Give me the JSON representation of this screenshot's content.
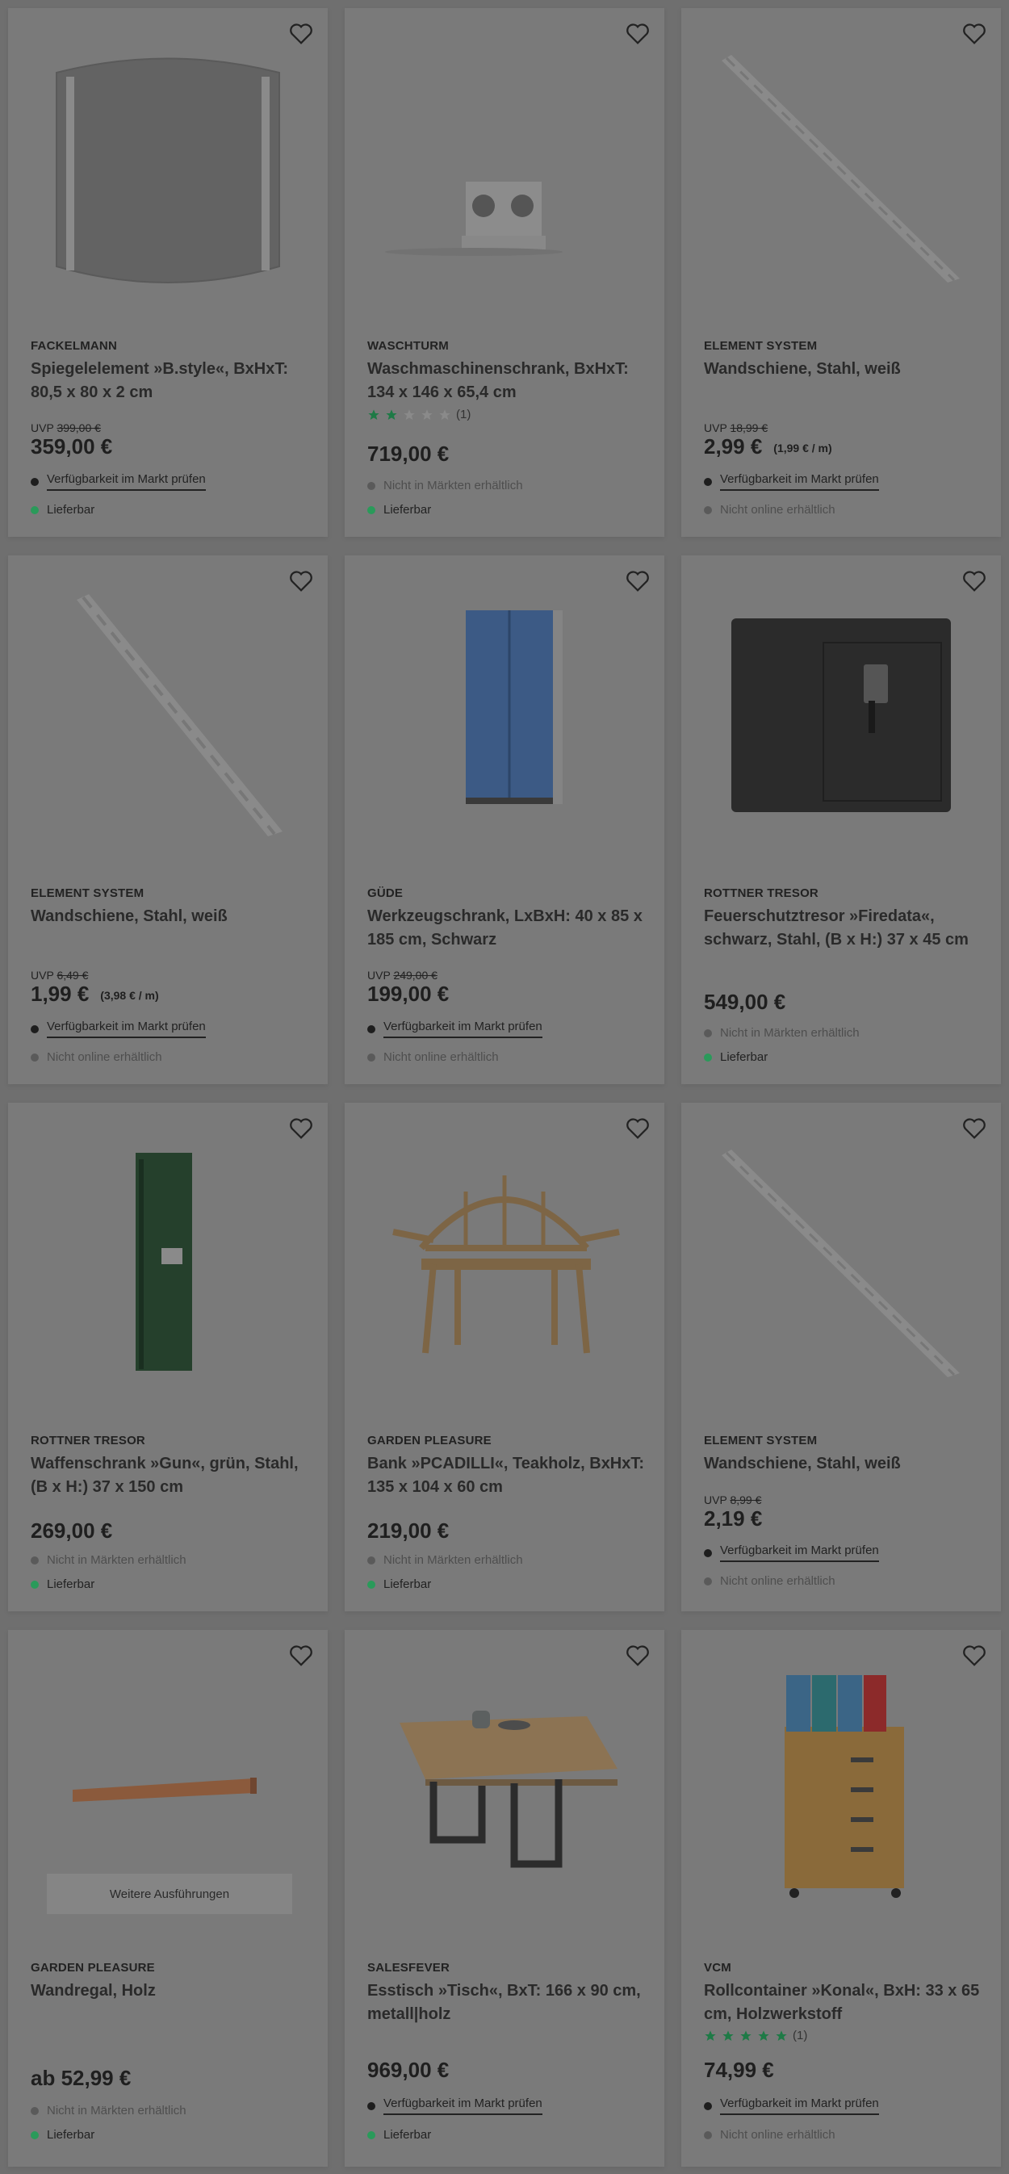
{
  "products": [
    {
      "brand": "FACKELMANN",
      "title": "Spiegelelement »B.style«, BxHxT: 80,5 x 80 x 2 cm",
      "uvp_label": "UVP",
      "uvp_price": "399,00 €",
      "price": "359,00 €",
      "availability": [
        {
          "label": "Verfügbarkeit im Markt prüfen",
          "status": "dark",
          "link": true
        },
        {
          "label": "Lieferbar",
          "status": "green",
          "link": false
        }
      ]
    },
    {
      "brand": "WASCHTURM",
      "title": "Waschmaschinenschrank, BxHxT: 134 x 146 x 65,4 cm",
      "rating": {
        "value": 2,
        "max": 5,
        "count": "(1)"
      },
      "price": "719,00 €",
      "availability": [
        {
          "label": "Nicht in Märkten erhältlich",
          "status": "grey",
          "link": false
        },
        {
          "label": "Lieferbar",
          "status": "green",
          "link": false
        }
      ]
    },
    {
      "brand": "ELEMENT SYSTEM",
      "title": "Wandschiene, Stahl, weiß",
      "uvp_label": "UVP",
      "uvp_price": "18,99 €",
      "price": "2,99 €",
      "unit_price": "(1,99 € / m)",
      "availability": [
        {
          "label": "Verfügbarkeit im Markt prüfen",
          "status": "dark",
          "link": true
        },
        {
          "label": "Nicht online erhältlich",
          "status": "grey",
          "link": false
        }
      ]
    },
    {
      "brand": "ELEMENT SYSTEM",
      "title": "Wandschiene, Stahl, weiß",
      "uvp_label": "UVP",
      "uvp_price": "6,49 €",
      "price": "1,99 €",
      "unit_price": "(3,98 € / m)",
      "availability": [
        {
          "label": "Verfügbarkeit im Markt prüfen",
          "status": "dark",
          "link": true
        },
        {
          "label": "Nicht online erhältlich",
          "status": "grey",
          "link": false
        }
      ]
    },
    {
      "brand": "GÜDE",
      "title": "Werkzeugschrank, LxBxH: 40 x 85 x 185 cm, Schwarz",
      "uvp_label": "UVP",
      "uvp_price": "249,00 €",
      "price": "199,00 €",
      "availability": [
        {
          "label": "Verfügbarkeit im Markt prüfen",
          "status": "dark",
          "link": true
        },
        {
          "label": "Nicht online erhältlich",
          "status": "grey",
          "link": false
        }
      ]
    },
    {
      "brand": "ROTTNER TRESOR",
      "title": "Feuerschutztresor »Firedata«, schwarz, Stahl, (B x H:) 37 x 45 cm",
      "price": "549,00 €",
      "availability": [
        {
          "label": "Nicht in Märkten erhältlich",
          "status": "grey",
          "link": false
        },
        {
          "label": "Lieferbar",
          "status": "green",
          "link": false
        }
      ]
    },
    {
      "brand": "ROTTNER TRESOR",
      "title": "Waffenschrank »Gun«, grün, Stahl, (B x H:) 37 x 150 cm",
      "price": "269,00 €",
      "availability": [
        {
          "label": "Nicht in Märkten erhältlich",
          "status": "grey",
          "link": false
        },
        {
          "label": "Lieferbar",
          "status": "green",
          "link": false
        }
      ]
    },
    {
      "brand": "GARDEN PLEASURE",
      "title": "Bank »PCADILLI«, Teakholz, BxHxT: 135 x 104 x 60 cm",
      "price": "219,00 €",
      "availability": [
        {
          "label": "Nicht in Märkten erhältlich",
          "status": "grey",
          "link": false
        },
        {
          "label": "Lieferbar",
          "status": "green",
          "link": false
        }
      ]
    },
    {
      "brand": "ELEMENT SYSTEM",
      "title": "Wandschiene, Stahl, weiß",
      "uvp_label": "UVP",
      "uvp_price": "8,99 €",
      "price": "2,19 €",
      "availability": [
        {
          "label": "Verfügbarkeit im Markt prüfen",
          "status": "dark",
          "link": true
        },
        {
          "label": "Nicht online erhältlich",
          "status": "grey",
          "link": false
        }
      ]
    },
    {
      "brand": "GARDEN PLEASURE",
      "title": "Wandregal, Holz",
      "variant_button": "Weitere Ausführungen",
      "price": "ab 52,99 €",
      "availability": [
        {
          "label": "Nicht in Märkten erhältlich",
          "status": "grey",
          "link": false
        },
        {
          "label": "Lieferbar",
          "status": "green",
          "link": false
        }
      ]
    },
    {
      "brand": "SALESFEVER",
      "title": "Esstisch »Tisch«, BxT: 166 x 90 cm, metall|holz",
      "price": "969,00 €",
      "availability": [
        {
          "label": "Verfügbarkeit im Markt prüfen",
          "status": "dark",
          "link": true
        },
        {
          "label": "Lieferbar",
          "status": "green",
          "link": false
        }
      ]
    },
    {
      "brand": "VCM",
      "title": "Rollcontainer »Konal«, BxH: 33 x 65 cm, Holzwerkstoff",
      "rating": {
        "value": 5,
        "max": 5,
        "count": "(1)"
      },
      "price": "74,99 €",
      "availability": [
        {
          "label": "Verfügbarkeit im Markt prüfen",
          "status": "dark",
          "link": true
        },
        {
          "label": "Nicht online erhältlich",
          "status": "grey",
          "link": false
        }
      ]
    }
  ]
}
